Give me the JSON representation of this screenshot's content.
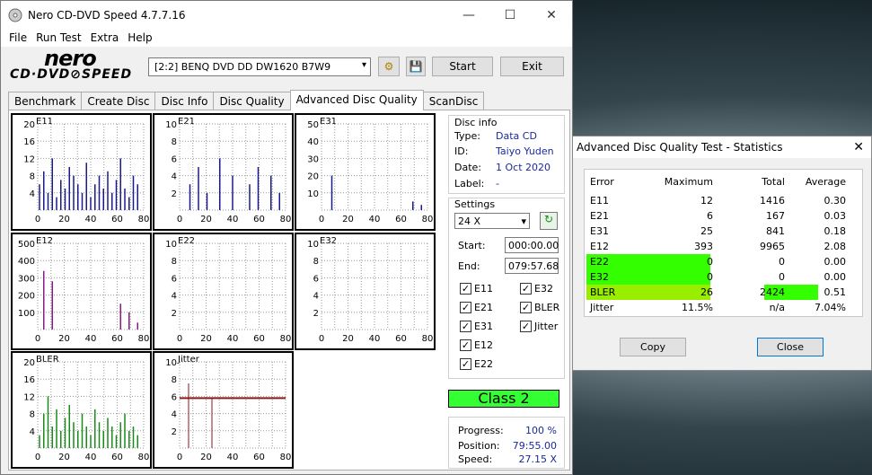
{
  "window": {
    "title": "Nero CD-DVD Speed 4.7.7.16",
    "minimize": "—",
    "maximize": "☐",
    "close": "✕"
  },
  "menu": [
    "File",
    "Run Test",
    "Extra",
    "Help"
  ],
  "logo": {
    "top": "nero",
    "bottom": "CD·DVD⊘SPEED"
  },
  "drive": "[2:2]   BENQ DVD DD DW1620 B7W9",
  "buttons": {
    "start": "Start",
    "exit": "Exit"
  },
  "tabs": [
    "Benchmark",
    "Create Disc",
    "Disc Info",
    "Disc Quality",
    "Advanced Disc Quality",
    "ScanDisc"
  ],
  "graphs": [
    {
      "name": "E11",
      "yticks": [
        "20",
        "16",
        "12",
        "8",
        "4"
      ],
      "xticks": [
        "0",
        "20",
        "40",
        "60",
        "80"
      ],
      "color": "#1a1a8a"
    },
    {
      "name": "E21",
      "yticks": [
        "10",
        "8",
        "6",
        "4",
        "2"
      ],
      "xticks": [
        "0",
        "20",
        "40",
        "60",
        "80"
      ],
      "color": "#1a1a8a"
    },
    {
      "name": "E31",
      "yticks": [
        "50",
        "40",
        "30",
        "20",
        "10"
      ],
      "xticks": [
        "0",
        "20",
        "40",
        "60",
        "80"
      ],
      "color": "#1a1a8a"
    },
    {
      "name": "E12",
      "yticks": [
        "500",
        "400",
        "300",
        "200",
        "100"
      ],
      "xticks": [
        "0",
        "20",
        "40",
        "60",
        "80"
      ],
      "color": "#8a1a8a"
    },
    {
      "name": "E22",
      "yticks": [
        "10",
        "8",
        "6",
        "4",
        "2"
      ],
      "xticks": [
        "0",
        "20",
        "40",
        "60",
        "80"
      ],
      "color": "#8a1a8a"
    },
    {
      "name": "E32",
      "yticks": [
        "10",
        "8",
        "6",
        "4",
        "2"
      ],
      "xticks": [
        "0",
        "20",
        "40",
        "60",
        "80"
      ],
      "color": "#8a1a8a"
    },
    {
      "name": "BLER",
      "yticks": [
        "20",
        "16",
        "12",
        "8",
        "4"
      ],
      "xticks": [
        "0",
        "20",
        "40",
        "60",
        "80"
      ],
      "color": "#1a8a1a"
    },
    {
      "name": "Jitter",
      "yticks": [
        "10",
        "8",
        "6",
        "4",
        "2"
      ],
      "xticks": [
        "0",
        "20",
        "40",
        "60",
        "80"
      ],
      "color": "#8a1a1a"
    }
  ],
  "discinfo": {
    "title": "Disc info",
    "type_l": "Type:",
    "type": "Data CD",
    "id_l": "ID:",
    "id": "Taiyo Yuden",
    "date_l": "Date:",
    "date": "1 Oct 2020",
    "label_l": "Label:",
    "label": "-"
  },
  "settings": {
    "title": "Settings",
    "speed": "24 X",
    "start_l": "Start:",
    "start": "000:00.00",
    "end_l": "End:",
    "end": "079:57.68"
  },
  "checks": [
    "E11",
    "E32",
    "E21",
    "BLER",
    "E31",
    "Jitter",
    "E12",
    "E22"
  ],
  "class": "Class 2",
  "progress": {
    "progress_l": "Progress:",
    "progress": "100 %",
    "position_l": "Position:",
    "position": "79:55.00",
    "speed_l": "Speed:",
    "speed": "27.15 X"
  },
  "stats": {
    "title": "Advanced Disc Quality Test - Statistics",
    "headers": [
      "Error",
      "Maximum",
      "Total",
      "Average"
    ],
    "rows": [
      [
        "E11",
        "12",
        "1416",
        "0.30"
      ],
      [
        "E21",
        "6",
        "167",
        "0.03"
      ],
      [
        "E31",
        "25",
        "841",
        "0.18"
      ],
      [
        "E12",
        "393",
        "9965",
        "2.08"
      ],
      [
        "E22",
        "0",
        "0",
        "0.00"
      ],
      [
        "E32",
        "0",
        "0",
        "0.00"
      ],
      [
        "BLER",
        "26",
        "2424",
        "0.51"
      ],
      [
        "Jitter",
        "11.5%",
        "n/a",
        "7.04%"
      ]
    ],
    "copy": "Copy",
    "close": "Close"
  }
}
